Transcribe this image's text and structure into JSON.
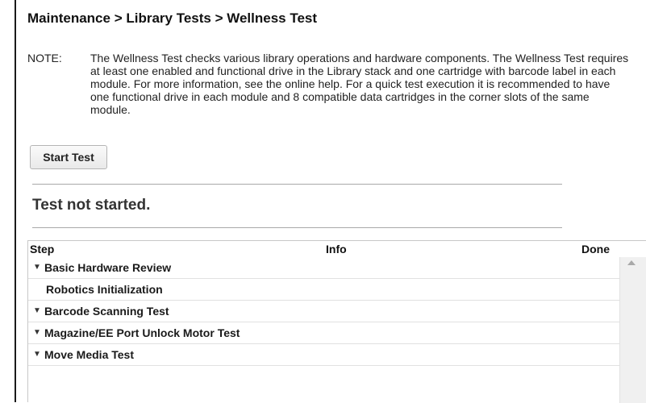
{
  "breadcrumb": "Maintenance > Library Tests > Wellness Test",
  "note": {
    "label": "NOTE:",
    "text": "The Wellness Test checks various library operations and hardware components. The Wellness Test requires at least one enabled and functional drive in the Library stack and one cartridge with barcode label in each module. For more information, see the online help. For a quick test execution it is recommended to have one functional drive in each module and 8 compatible data cartridges in the corner slots of the same module."
  },
  "start_button": "Start Test",
  "status": "Test not started.",
  "table": {
    "headers": {
      "step": "Step",
      "info": "Info",
      "done": "Done"
    },
    "rows": [
      {
        "label": "Basic Hardware Review",
        "expanded": true,
        "icon": "triangle-down-icon"
      },
      {
        "label": "Robotics Initialization",
        "child": true
      },
      {
        "label": "Barcode Scanning Test",
        "expanded": true,
        "icon": "triangle-down-icon"
      },
      {
        "label": "Magazine/EE Port Unlock Motor Test",
        "expanded": true,
        "icon": "triangle-down-icon"
      },
      {
        "label": "Move Media Test",
        "expanded": true,
        "icon": "triangle-down-icon"
      }
    ]
  },
  "icons": {
    "expand": "▼",
    "scroll_up": "scroll-up-arrow-icon"
  }
}
